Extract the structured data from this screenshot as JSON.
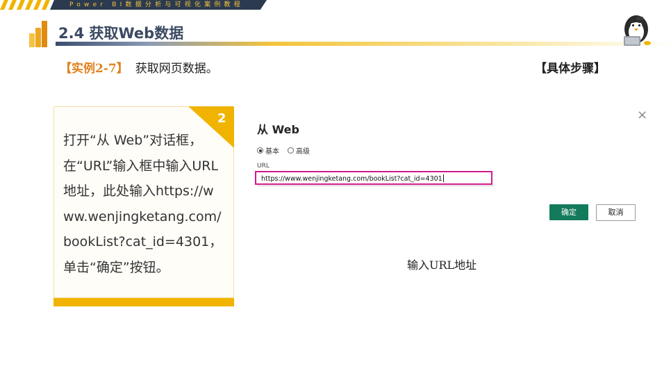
{
  "banner": {
    "text": "Power BI数据分析与可视化案例教程"
  },
  "header": {
    "title": "2.4  获取Web数据"
  },
  "example": {
    "tag": "【实例2-7】",
    "description": "获取网页数据。"
  },
  "steps_label": "【具体步骤】",
  "card": {
    "number": "2",
    "text": "打开“从 Web”对话框，在“URL”输入框中输入URL 地址，此处输入https://www.wenjingketang.com/bookList?cat_id=4301，单击“确定”按钮。"
  },
  "dialog": {
    "title": "从 Web",
    "close_glyph": "×",
    "radio_basic": "基本",
    "radio_advanced": "高级",
    "url_label": "URL",
    "url_value": "https://www.wenjingketang.com/bookList?cat_id=4301",
    "ok_label": "确定",
    "cancel_label": "取消"
  },
  "caption": "输入URL地址",
  "colors": {
    "accent_yellow": "#f0b400",
    "dark_navy": "#2b3a4e",
    "ok_green": "#147a5c",
    "highlight_magenta": "#d11a8b"
  }
}
